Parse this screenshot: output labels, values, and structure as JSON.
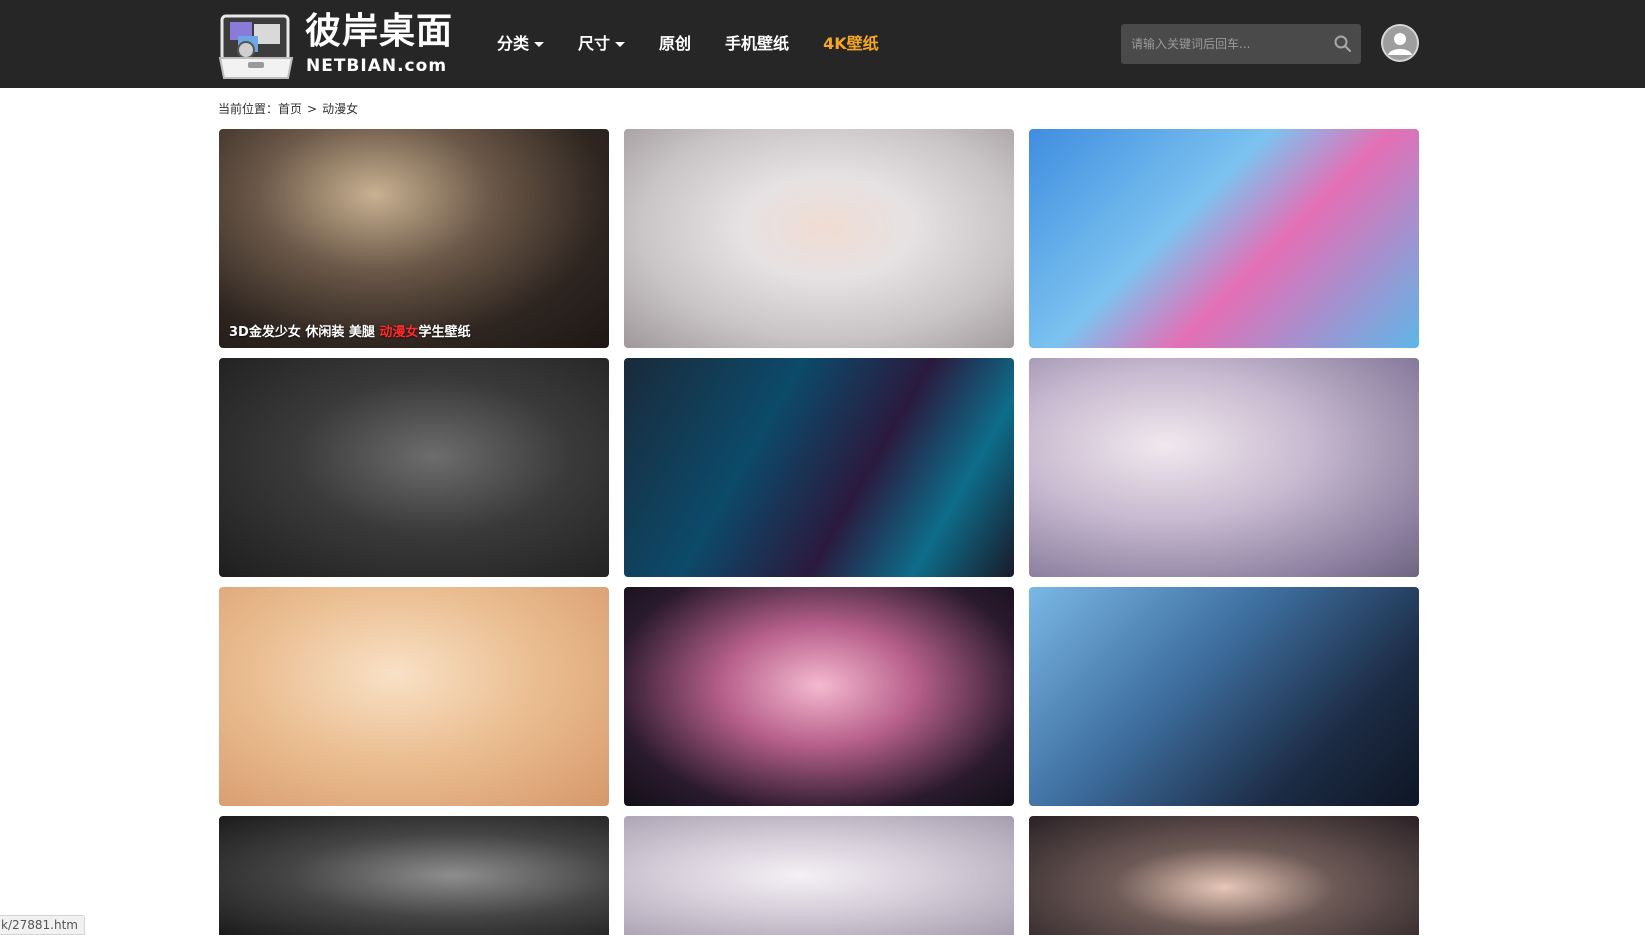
{
  "header": {
    "logo_title": "彼岸桌面",
    "logo_sub": "NETBIAN.com",
    "nav": [
      {
        "label": "分类",
        "dropdown": true,
        "highlight": false
      },
      {
        "label": "尺寸",
        "dropdown": true,
        "highlight": false
      },
      {
        "label": "原创",
        "dropdown": false,
        "highlight": false
      },
      {
        "label": "手机壁纸",
        "dropdown": false,
        "highlight": false
      },
      {
        "label": "4K壁纸",
        "dropdown": false,
        "highlight": true
      }
    ],
    "search": {
      "placeholder": "请输入关键词后回车...",
      "icon": "search-icon"
    },
    "avatar_icon": "user-icon"
  },
  "breadcrumb": {
    "prefix": "当前位置：",
    "home": "首页",
    "separator": ">",
    "current": "动漫女"
  },
  "gallery": {
    "first_caption": {
      "before": "3D金发少女 休闲装 美腿 ",
      "highlight": "动漫女",
      "after": "学生壁纸"
    }
  },
  "status_url": "k/27881.htm",
  "colors": {
    "topbar": "#262626",
    "nav_highlight": "#f5a623",
    "caption_highlight": "#ff2a2a"
  }
}
